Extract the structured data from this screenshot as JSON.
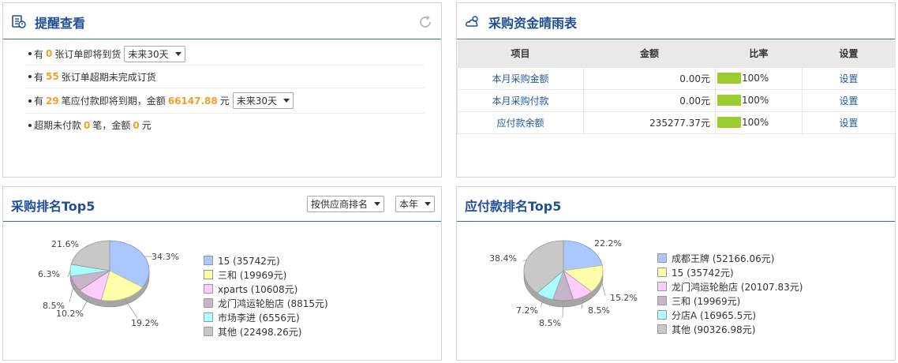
{
  "reminder": {
    "title": "提醒查看",
    "items": [
      {
        "pre": "有",
        "num": "0",
        "post": "张订单即将到货",
        "select": "未来30天"
      },
      {
        "pre": "有",
        "num": "55",
        "post": "张订单超期未完成订货"
      },
      {
        "pre": "有",
        "num": "29",
        "mid": "笔应付款即将到期，金额",
        "amount": "66147.88",
        "post": "元",
        "select": "未来30天"
      },
      {
        "pre": "超期未付款",
        "num": "0",
        "mid": "笔，金额",
        "amount": "0",
        "post": "元"
      }
    ]
  },
  "funds": {
    "title": "采购资金晴雨表",
    "headers": [
      "项目",
      "金额",
      "比率",
      "设置"
    ],
    "rows": [
      {
        "item": "本月采购金额",
        "amount": "0.00元",
        "rate": "100%",
        "action": "设置"
      },
      {
        "item": "本月采购付款",
        "amount": "0.00元",
        "rate": "100%",
        "action": "设置"
      },
      {
        "item": "应付款余额",
        "amount": "235277.37元",
        "rate": "100%",
        "action": "设置"
      }
    ],
    "bar_color": "#9acd32"
  },
  "purchase_rank": {
    "title": "采购排名Top5",
    "sort_select": "按供应商排名",
    "period_select": "本年"
  },
  "payable_rank": {
    "title": "应付款排名Top5"
  },
  "chart_data": [
    {
      "type": "pie",
      "title": "采购排名Top5",
      "labels": [
        "15",
        "三和",
        "xparts",
        "龙门鸿运轮胎店",
        "市场李进",
        "其他"
      ],
      "legend": [
        "15 (35742元)",
        "三和 (19969元)",
        "xparts (10608元)",
        "龙门鸿运轮胎店 (8815元)",
        "市场李进 (6556元)",
        "其他 (22498.26元)"
      ],
      "values": [
        35742,
        19969,
        10608,
        8815,
        6556,
        22498.26
      ],
      "percent_labels": [
        "34.3%",
        "19.2%",
        "10.2%",
        "8.5%",
        "6.3%",
        "21.6%"
      ],
      "colors": [
        "#aac8ff",
        "#ffffaa",
        "#ffccff",
        "#c8b4c8",
        "#aaffff",
        "#c8c8c8"
      ]
    },
    {
      "type": "pie",
      "title": "应付款排名Top5",
      "labels": [
        "成都王牌",
        "15",
        "龙门鸿运轮胎店",
        "三和",
        "分店A",
        "其他"
      ],
      "legend": [
        "成都王牌 (52166.06元)",
        "15 (35742元)",
        "龙门鸿运轮胎店 (20107.83元)",
        "三和 (19969元)",
        "分店A (16965.5元)",
        "其他 (90326.98元)"
      ],
      "values": [
        52166.06,
        35742,
        20107.83,
        19969,
        16965.5,
        90326.98
      ],
      "percent_labels": [
        "22.2%",
        "15.2%",
        "8.5%",
        "8.5%",
        "7.2%",
        "38.4%"
      ],
      "colors": [
        "#aac8ff",
        "#ffffaa",
        "#ffccff",
        "#c8b4c8",
        "#aaffff",
        "#c8c8c8"
      ]
    }
  ]
}
